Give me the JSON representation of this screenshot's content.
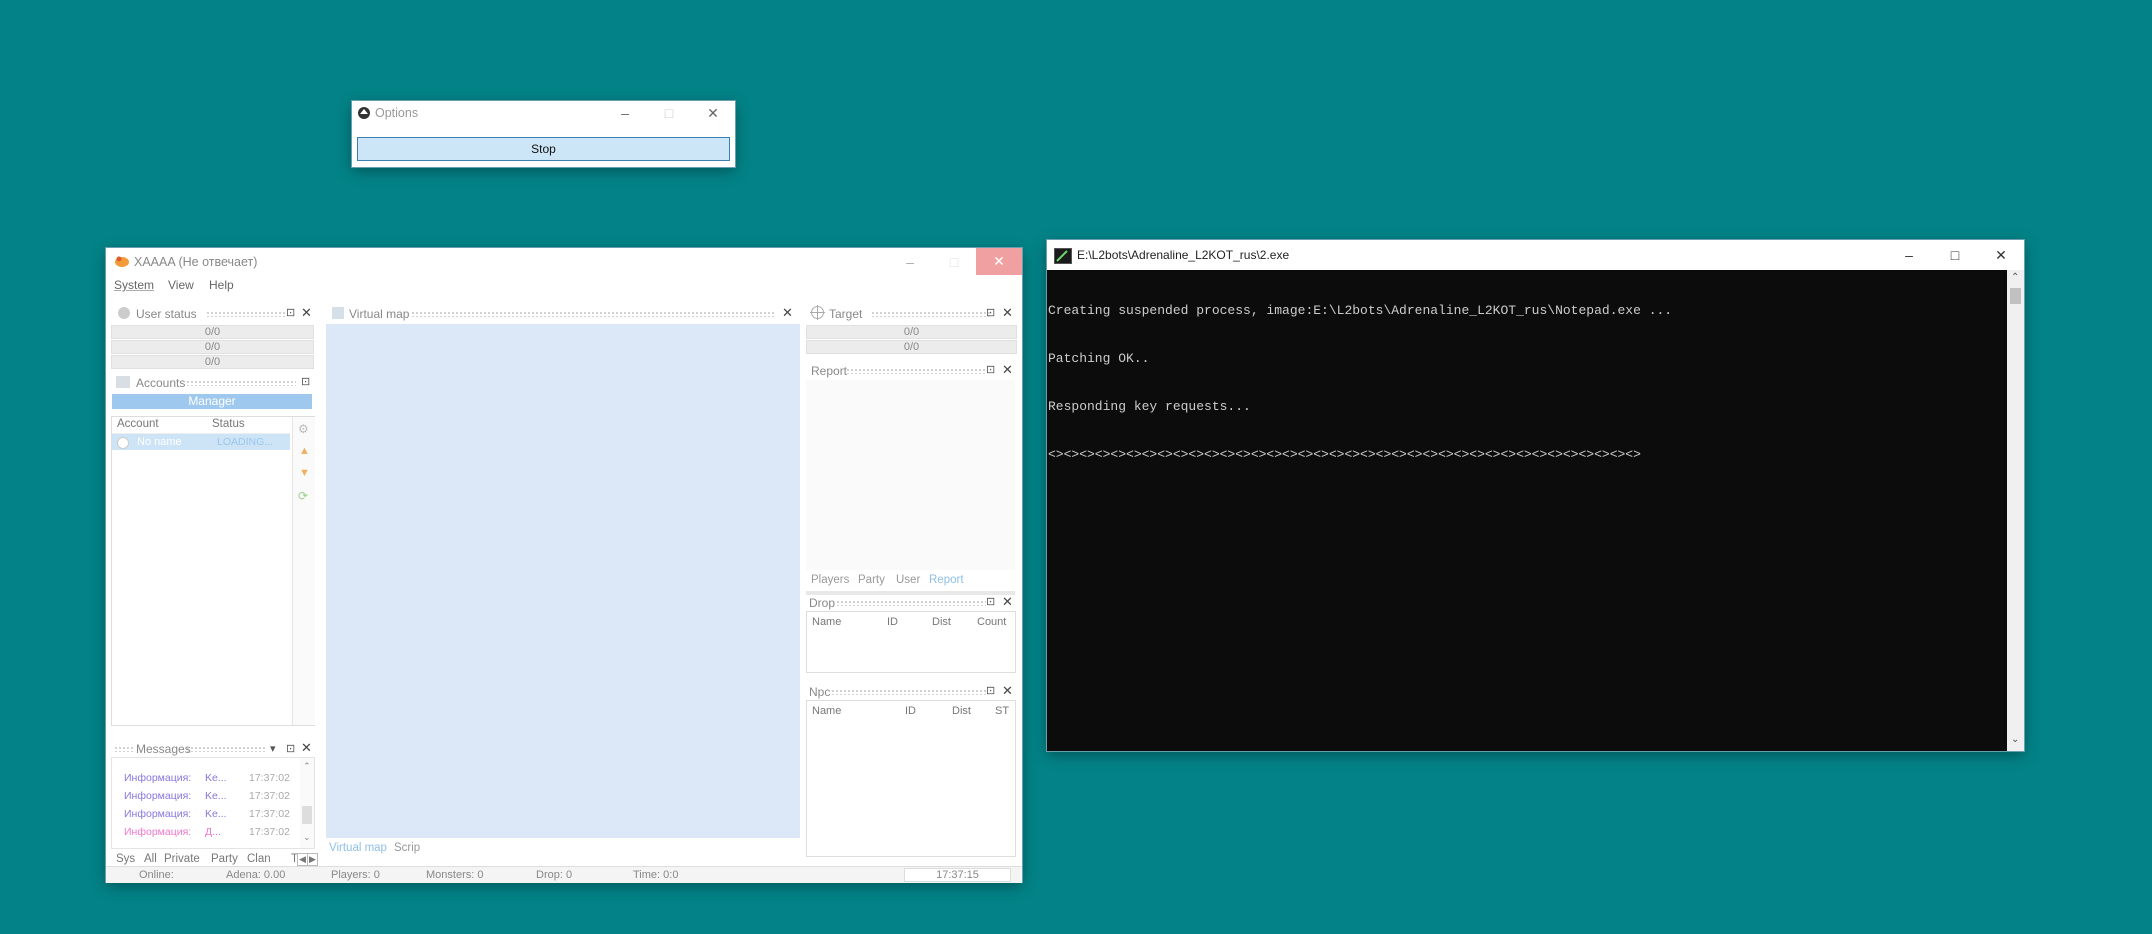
{
  "options_window": {
    "title": "Options",
    "stop_button": "Stop"
  },
  "bot_window": {
    "title": "XAAAA (Не отвечает)",
    "menu": [
      "System",
      "View",
      "Help"
    ],
    "user_status": {
      "title": "User status",
      "bars": [
        "0/0",
        "0/0",
        "0/0"
      ]
    },
    "accounts": {
      "title": "Accounts",
      "manager_label": "Manager",
      "columns": [
        "Account",
        "Status"
      ],
      "rows": [
        {
          "account": "No name",
          "status": "LOADING..."
        }
      ]
    },
    "virtual_map": {
      "title": "Virtual map",
      "tabs": [
        "Virtual map",
        "Scrip"
      ]
    },
    "target": {
      "title": "Target",
      "bars": [
        "0/0",
        "0/0"
      ]
    },
    "report": {
      "title": "Report",
      "tabs": [
        "Players",
        "Party",
        "User",
        "Report"
      ]
    },
    "drop": {
      "title": "Drop",
      "columns": [
        "Name",
        "ID",
        "Dist",
        "Count"
      ]
    },
    "npc": {
      "title": "Npc",
      "columns": [
        "Name",
        "ID",
        "Dist",
        "ST"
      ]
    },
    "messages": {
      "title": "Messages",
      "rows": [
        {
          "type": "Информация:",
          "text": "Ke...",
          "time": "17:37:02"
        },
        {
          "type": "Информация:",
          "text": "Ke...",
          "time": "17:37:02"
        },
        {
          "type": "Информация:",
          "text": "Ke...",
          "time": "17:37:02"
        },
        {
          "type": "Информация:",
          "text": "Д...",
          "time": "17:37:02"
        }
      ],
      "tabs": [
        "Sys",
        "All",
        "Private",
        "Party",
        "Clan",
        "T"
      ]
    },
    "statusbar": {
      "online": "Online:",
      "adena": "Adena: 0.00",
      "players": "Players: 0",
      "monsters": "Monsters: 0",
      "drop": "Drop: 0",
      "time": "Time: 0:0",
      "clock": "17:37:15"
    }
  },
  "console_window": {
    "title": "E:\\L2bots\\Adrenaline_L2KOT_rus\\2.exe",
    "lines": [
      "Creating suspended process, image:E:\\L2bots\\Adrenaline_L2KOT_rus\\Notepad.exe ...",
      "Patching OK..",
      "Responding key requests...",
      "<><><><><><><><><><><><><><><><><><><><><><><><><><><><><><><><><><><><><><>"
    ]
  }
}
